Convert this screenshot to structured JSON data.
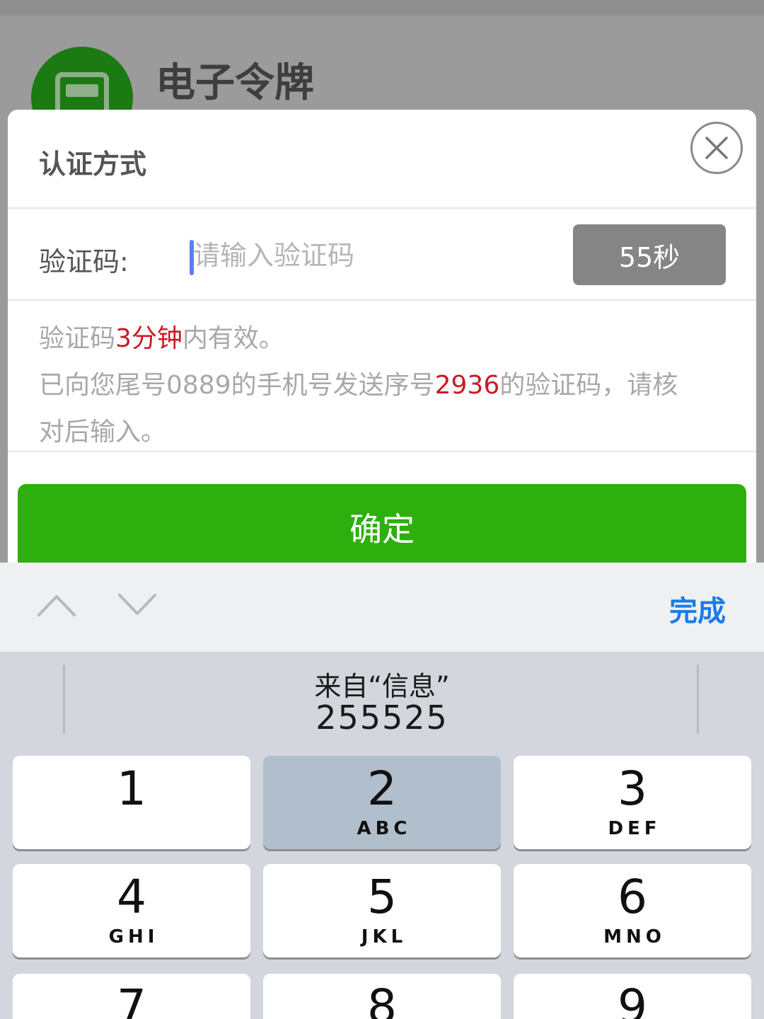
{
  "background_app": {
    "title": "电子令牌"
  },
  "dialog": {
    "title": "认证方式",
    "code_label": "验证码:",
    "code_placeholder": "请输入验证码",
    "code_value": "",
    "timer_label": "55秒",
    "notice_line1": {
      "pre": "验证码",
      "highlight": "3分钟",
      "post": "内有效。"
    },
    "notice_line2": {
      "pre": "已向您尾号0889的手机号发送序号",
      "highlight": "2936",
      "post": "的验证码，请核"
    },
    "notice_line3": "对后输入。",
    "confirm_label": "确定"
  },
  "keyboard_toolbar": {
    "up_icon": "chevron-up-icon",
    "down_icon": "chevron-down-icon",
    "done_label": "完成"
  },
  "keyboard": {
    "suggestion_source": "来自“信息”",
    "suggestion_code": "255525",
    "keys": [
      {
        "num": "1",
        "letters": ""
      },
      {
        "num": "2",
        "letters": "ABC"
      },
      {
        "num": "3",
        "letters": "DEF"
      },
      {
        "num": "4",
        "letters": "GHI"
      },
      {
        "num": "5",
        "letters": "JKL"
      },
      {
        "num": "6",
        "letters": "MNO"
      },
      {
        "num": "7",
        "letters": ""
      },
      {
        "num": "8",
        "letters": ""
      },
      {
        "num": "9",
        "letters": ""
      }
    ]
  },
  "colors": {
    "accent_green": "#2db00d",
    "highlight_red": "#cc1a23",
    "link_blue": "#1a7be8"
  }
}
